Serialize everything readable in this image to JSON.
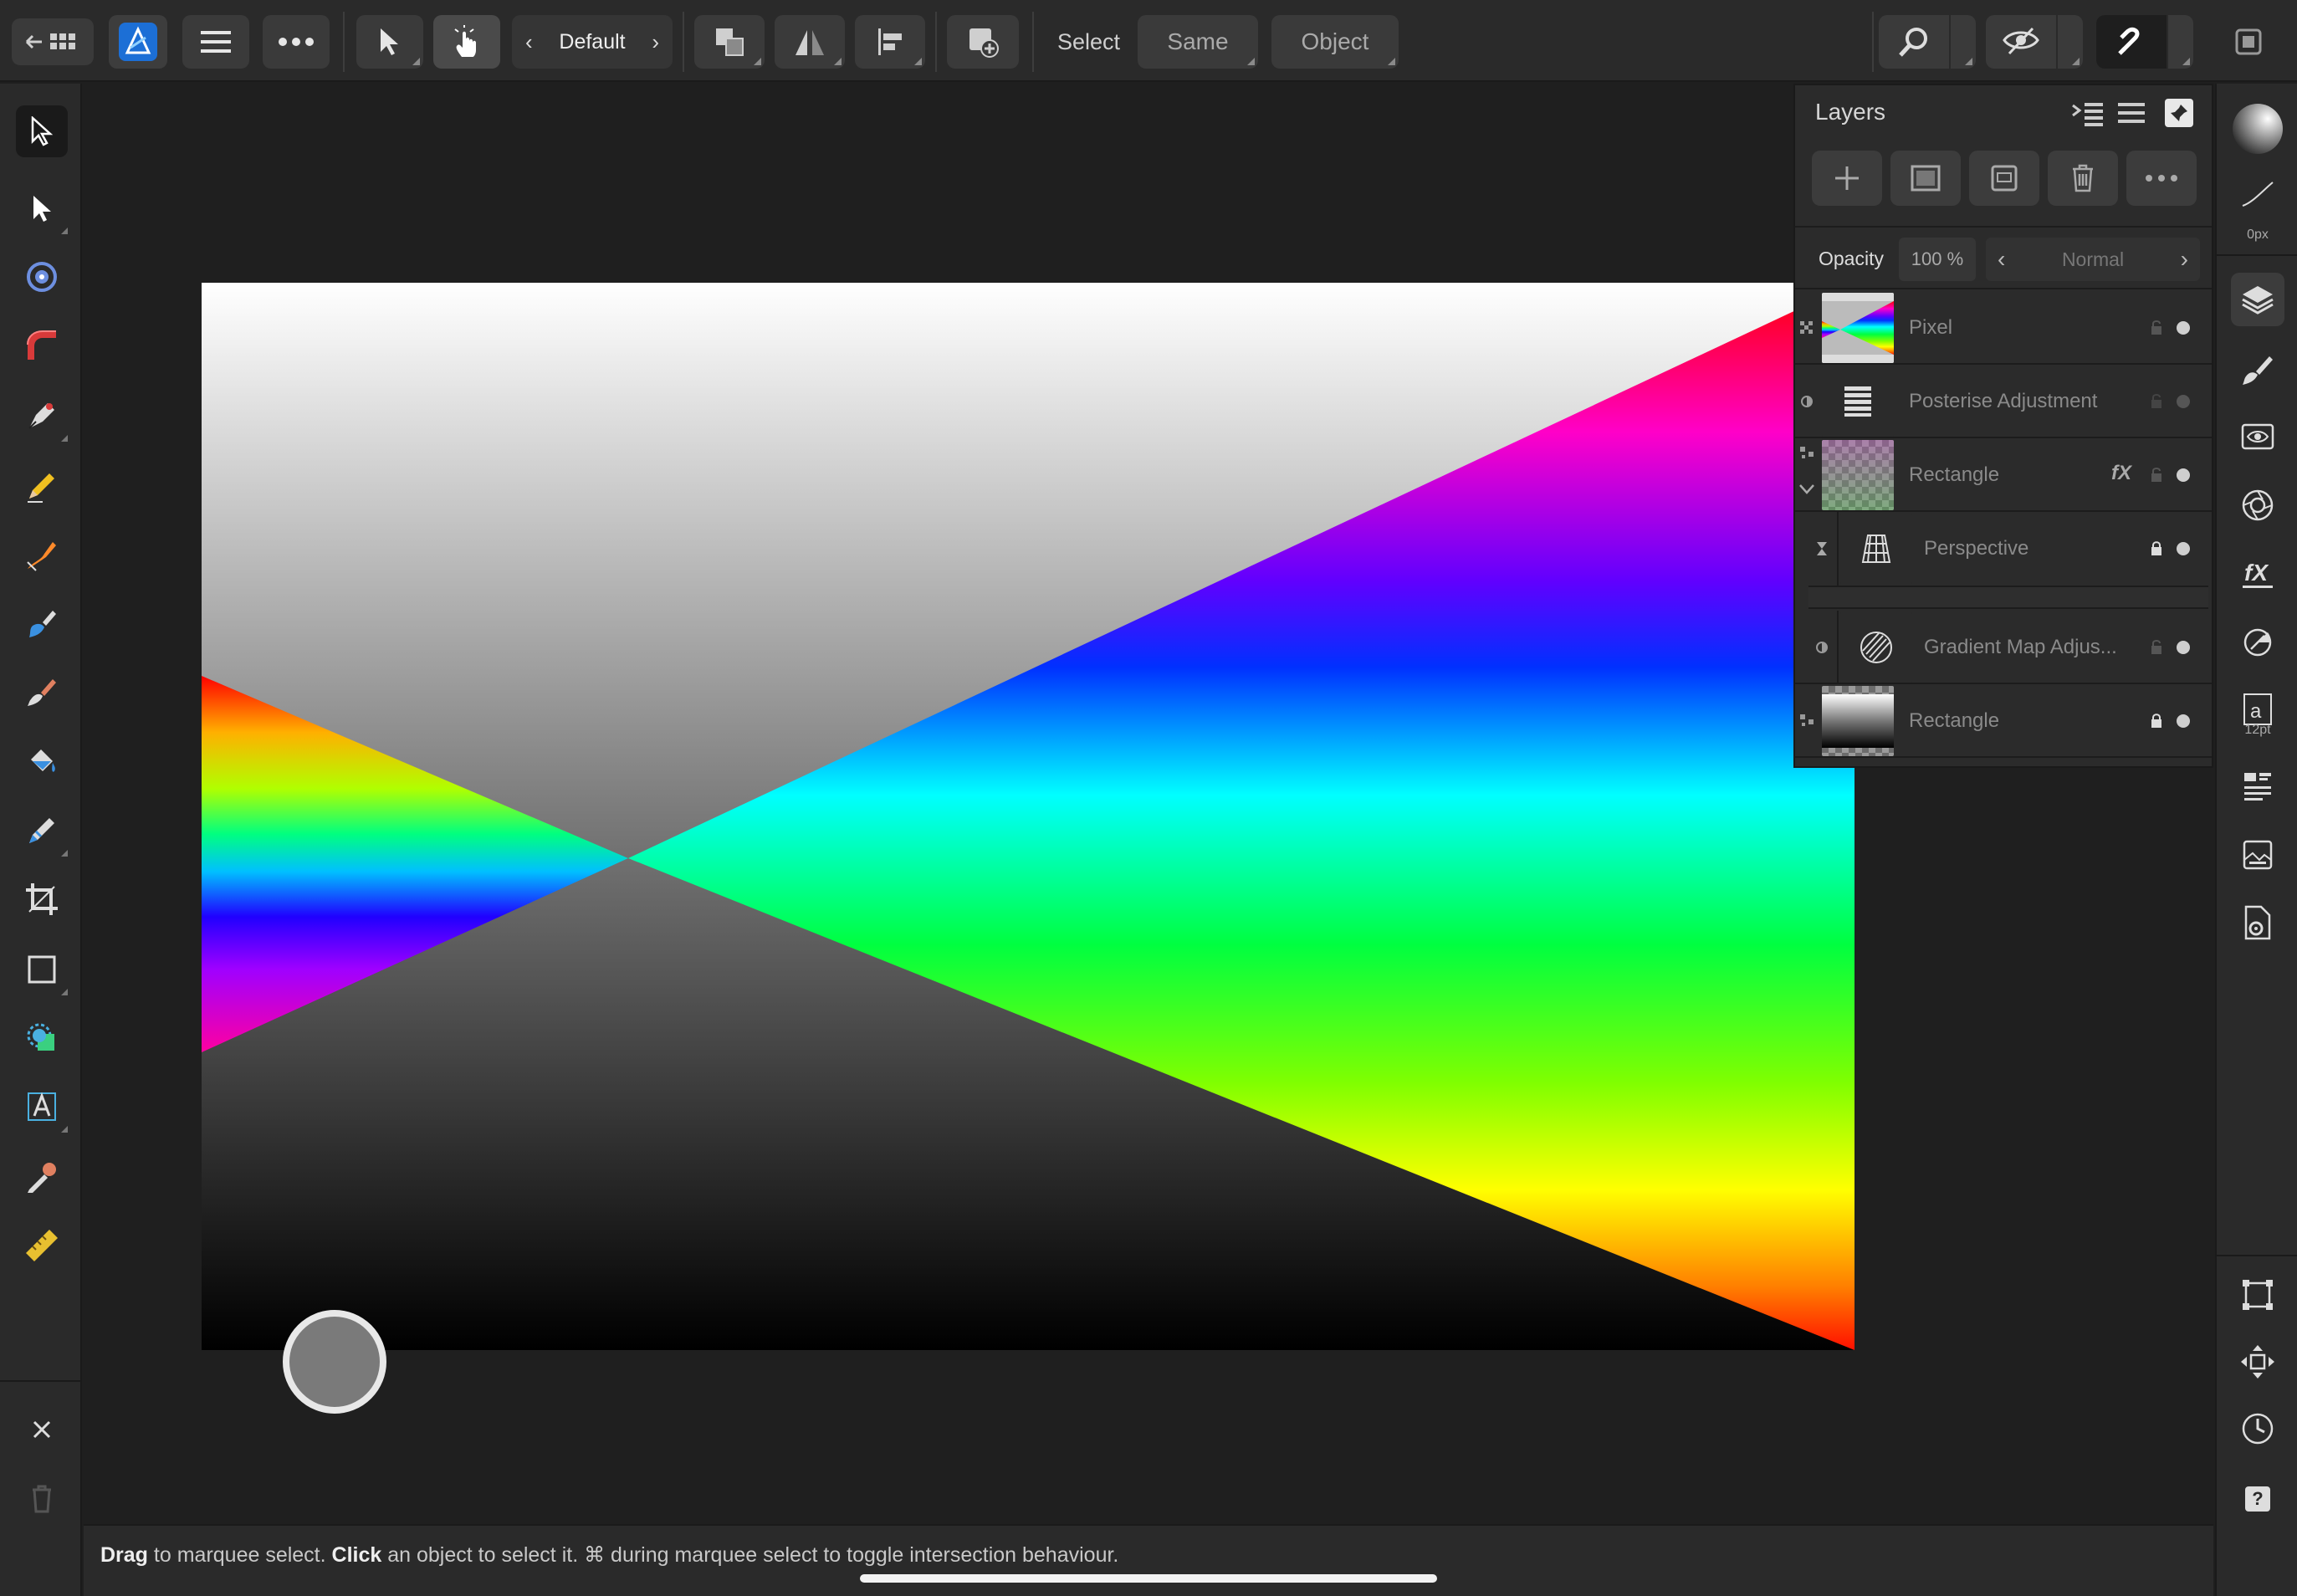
{
  "toolbar": {
    "persona_label": "Default",
    "select_label": "Select",
    "same_label": "Same",
    "object_label": "Object"
  },
  "layers_panel": {
    "title": "Layers",
    "opacity_label": "Opacity",
    "opacity_value": "100 %",
    "blend_mode": "Normal",
    "layers": [
      {
        "name": "Pixel"
      },
      {
        "name": "Posterise Adjustment"
      },
      {
        "name": "Rectangle",
        "fx": "fX"
      },
      {
        "name": "Perspective"
      },
      {
        "name": "Gradient Map Adjus..."
      },
      {
        "name": "Rectangle"
      }
    ]
  },
  "right_strip": {
    "stroke_width": "0px",
    "font_size": "12pt"
  },
  "status": {
    "drag_word": "Drag",
    "part1": " to marquee select. ",
    "click_word": "Click",
    "part2": " an object to select it. ⌘ during marquee select to toggle intersection behaviour."
  },
  "colors": {
    "accent": "#2f8fe8",
    "panel_bg": "#2b2b2b",
    "canvas_bg": "#1f1f1f"
  }
}
